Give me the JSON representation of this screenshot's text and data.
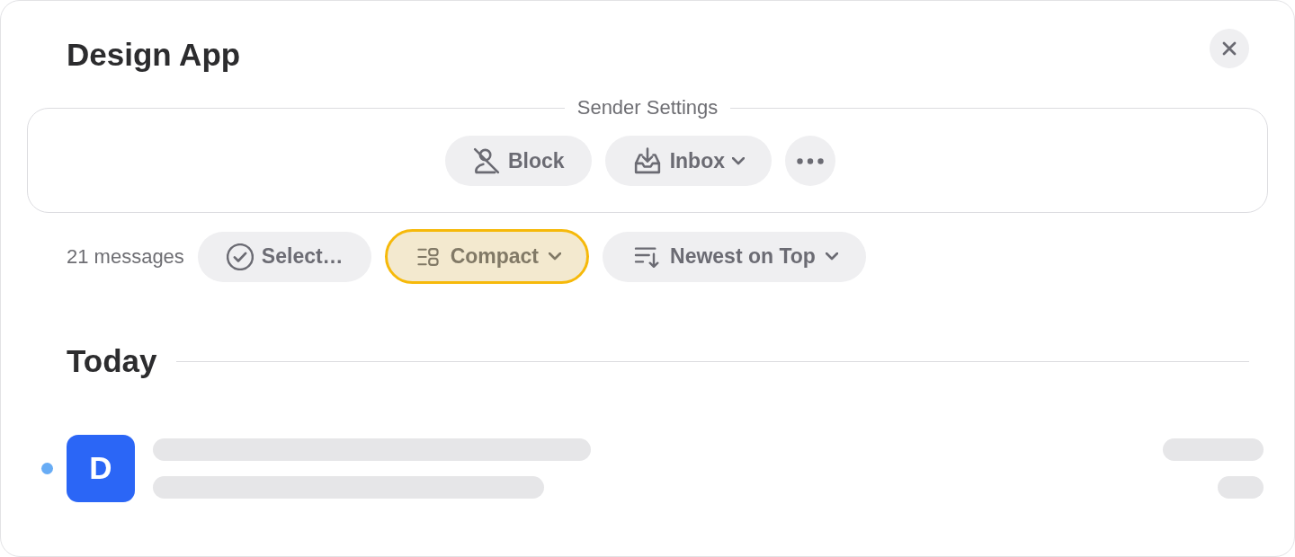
{
  "window": {
    "title": "Design App"
  },
  "sender_settings": {
    "legend": "Sender Settings",
    "buttons": [
      {
        "kind": "button",
        "label": "Block"
      },
      {
        "kind": "dropdown",
        "label": "Inbox"
      },
      {
        "kind": "more"
      }
    ]
  },
  "toolbar": {
    "count": "21 messages",
    "controls": [
      {
        "kind": "button",
        "label": "Select…",
        "focused": false
      },
      {
        "kind": "dropdown",
        "label": "Compact",
        "focused": true
      },
      {
        "kind": "dropdown",
        "label": "Newest on Top",
        "focused": false
      }
    ]
  },
  "sections": [
    {
      "heading": "Today",
      "messages": [
        {
          "avatar": "D",
          "unread": true,
          "color": "#2b66f6"
        }
      ]
    }
  ]
}
